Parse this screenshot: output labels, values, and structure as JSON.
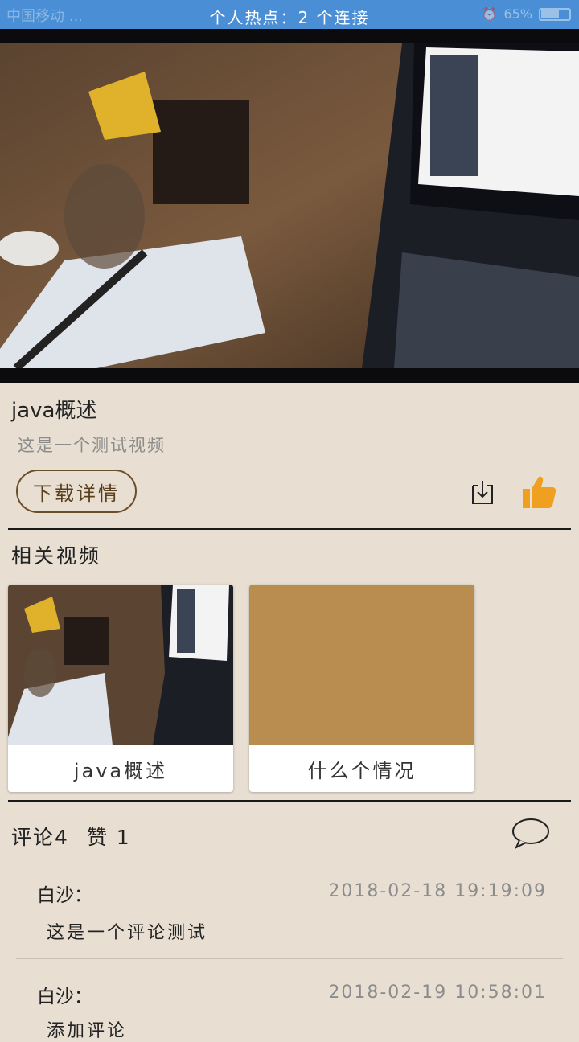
{
  "status_bar": {
    "carrier": "中国移动 ...",
    "hotspot": "个人热点：2 个连接",
    "battery": "65%",
    "battery_level": 0.65
  },
  "video": {
    "title": "java概述",
    "description": "这是一个测试视频",
    "download_label": "下载详情"
  },
  "related": {
    "heading": "相关视频",
    "items": [
      {
        "caption": "java概述"
      },
      {
        "caption": "什么个情况",
        "color": "#b98c50"
      }
    ]
  },
  "comments": {
    "count_label": "评论4",
    "likes_label": "赞 1",
    "items": [
      {
        "user": "白沙：",
        "time": "2018-02-18 19:19:09",
        "text": "这是一个评论测试"
      },
      {
        "user": "白沙：",
        "time": "2018-02-19 10:58:01",
        "text": "添加评论"
      }
    ]
  },
  "colors": {
    "status_bar": "#4a8fd6",
    "background": "#e8dfd2",
    "like": "#f0a020"
  }
}
